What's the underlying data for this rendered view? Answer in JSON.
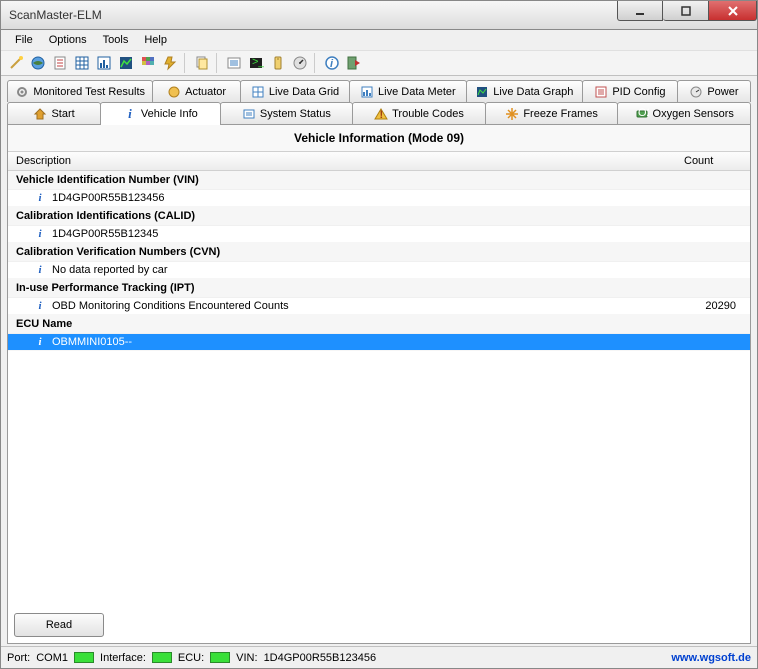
{
  "window": {
    "title": "ScanMaster-ELM"
  },
  "menu": {
    "file": "File",
    "options": "Options",
    "tools": "Tools",
    "help": "Help"
  },
  "tabs_row1": {
    "monitored": "Monitored Test Results",
    "actuator": "Actuator",
    "livegrid": "Live Data Grid",
    "livemeter": "Live Data Meter",
    "livegraph": "Live Data Graph",
    "pidconfig": "PID Config",
    "power": "Power"
  },
  "tabs_row2": {
    "start": "Start",
    "vehicleinfo": "Vehicle Info",
    "systemstatus": "System Status",
    "troublecodes": "Trouble Codes",
    "freezeframes": "Freeze Frames",
    "oxygen": "Oxygen Sensors"
  },
  "panel": {
    "title": "Vehicle Information (Mode 09)",
    "col_desc": "Description",
    "col_count": "Count"
  },
  "tree": {
    "g1": "Vehicle Identification Number (VIN)",
    "g1_i1": "1D4GP00R55B123456",
    "g2": "Calibration Identifications (CALID)",
    "g2_i1": "1D4GP00R55B12345",
    "g3": "Calibration Verification Numbers (CVN)",
    "g3_i1": "No data reported by car",
    "g4": "In-use Performance Tracking (IPT)",
    "g4_i1": "OBD Monitoring Conditions Encountered Counts",
    "g4_i1_cnt": "20290",
    "g5": "ECU Name",
    "g5_i1": "OBMMINI0105--"
  },
  "buttons": {
    "read": "Read"
  },
  "status": {
    "port_lbl": "Port:",
    "port_val": "COM1",
    "iface_lbl": "Interface:",
    "ecu_lbl": "ECU:",
    "vin_lbl": "VIN:",
    "vin_val": "1D4GP00R55B123456",
    "link": "www.wgsoft.de"
  }
}
